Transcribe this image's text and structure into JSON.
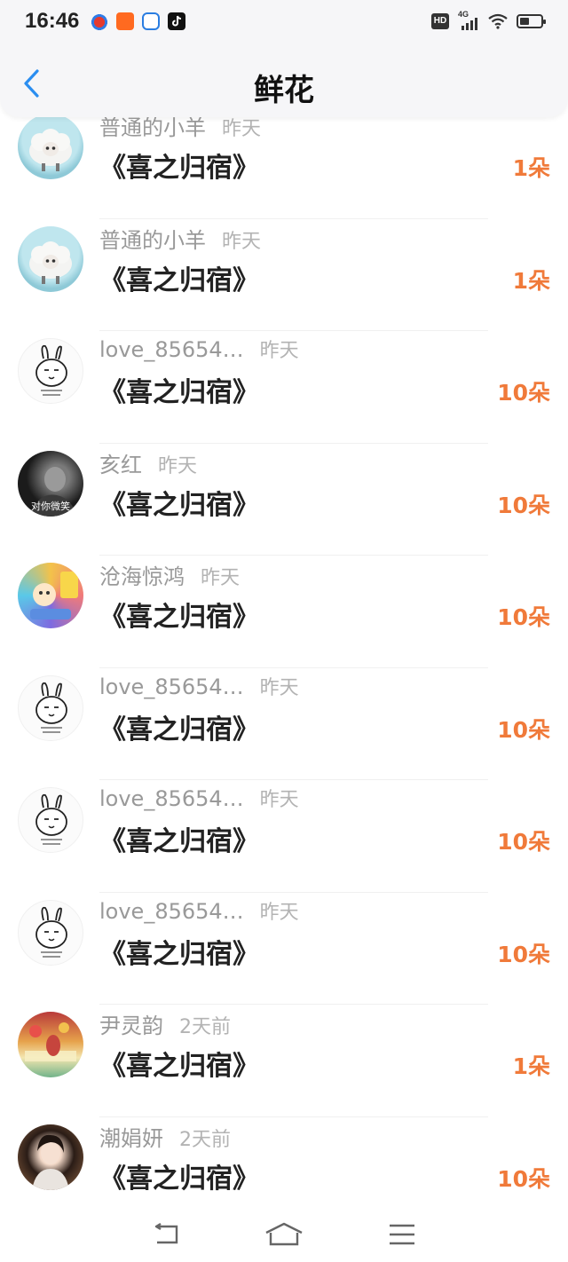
{
  "status_bar": {
    "time": "16:46",
    "network": "4G",
    "badge": "HD",
    "battery_level": 0.45,
    "notification_icons": [
      "weibo-icon",
      "app-grid-icon",
      "cloud-drive-icon",
      "tiktok-icon"
    ]
  },
  "header": {
    "title": "鲜花",
    "back_icon": "chevron-left-icon",
    "accent_color": "#2b8ef0"
  },
  "colors": {
    "count": "#f07a3a",
    "name": "#999999",
    "time": "#b3b3b3"
  },
  "rows": [
    {
      "name": "普通的小羊",
      "time": "昨天",
      "work": "《喜之归宿》",
      "count": "1朵",
      "avatar": "sheep-avatar"
    },
    {
      "name": "普通的小羊",
      "time": "昨天",
      "work": "《喜之归宿》",
      "count": "1朵",
      "avatar": "sheep-avatar"
    },
    {
      "name": "love_85654…",
      "time": "昨天",
      "work": "《喜之归宿》",
      "count": "10朵",
      "avatar": "bunny-avatar"
    },
    {
      "name": "亥红",
      "time": "昨天",
      "work": "《喜之归宿》",
      "count": "10朵",
      "avatar": "photo-avatar",
      "avatar_caption": "对你微笑"
    },
    {
      "name": "沧海惊鸿",
      "time": "昨天",
      "work": "《喜之归宿》",
      "count": "10朵",
      "avatar": "cartoon-avatar"
    },
    {
      "name": "love_85654…",
      "time": "昨天",
      "work": "《喜之归宿》",
      "count": "10朵",
      "avatar": "bunny-avatar"
    },
    {
      "name": "love_85654…",
      "time": "昨天",
      "work": "《喜之归宿》",
      "count": "10朵",
      "avatar": "bunny-avatar"
    },
    {
      "name": "love_85654…",
      "time": "昨天",
      "work": "《喜之归宿》",
      "count": "10朵",
      "avatar": "bunny-avatar"
    },
    {
      "name": "尹灵韵",
      "time": "2天前",
      "work": "《喜之归宿》",
      "count": "1朵",
      "avatar": "floral-avatar"
    },
    {
      "name": "潮娟妍",
      "time": "2天前",
      "work": "《喜之归宿》",
      "count": "10朵",
      "avatar": "portrait-avatar"
    }
  ],
  "bottom_nav": [
    "back-nav-icon",
    "home-nav-icon",
    "menu-nav-icon"
  ]
}
